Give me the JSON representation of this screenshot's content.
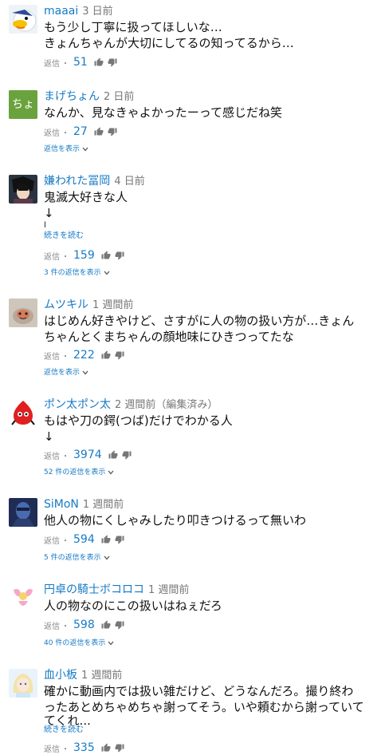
{
  "ui": {
    "reply_label": "返信",
    "dot": "・",
    "read_more": "続きを読む",
    "show_replies": "返信を表示"
  },
  "comments": [
    {
      "author": "maaai",
      "time": "3 日前",
      "lines": [
        "もう少し丁寧に扱ってほしいな…",
        "きょんちゃんが大切にしてるの知ってるから…"
      ],
      "likes": "51",
      "avatar": {
        "type": "duck-icon",
        "colors": [
          "#f3c200",
          "#ffffff",
          "#f26a1b"
        ]
      }
    },
    {
      "author": "まげちょん",
      "time": "2 日前",
      "lines": [
        "なんか、見なきゃよかったーって感じだね笑"
      ],
      "likes": "27",
      "show_replies": "返信を表示",
      "avatar": {
        "type": "initials",
        "text": "ちょ",
        "bg": "#6aa33d"
      }
    },
    {
      "author": "嫌われた冨岡",
      "time": "4 日前",
      "lines": [
        "鬼滅大好きな人",
        "↓",
        "l"
      ],
      "read_more": "続きを読む",
      "likes": "159",
      "show_replies": "3 件の返信を表示",
      "avatar": {
        "type": "anime-portrait-icon",
        "colors": [
          "#1f2530",
          "#f0d6c0"
        ]
      }
    },
    {
      "author": "ムツキル",
      "time": "1 週間前",
      "lines": [
        "はじめん好きやけど、さすがに人の物の扱い方が…きょん",
        "ちゃんとくまちゃんの顔地味にひきつってたな"
      ],
      "likes": "222",
      "show_replies": "返信を表示",
      "avatar": {
        "type": "animal-photo-icon",
        "colors": [
          "#b8a898",
          "#d87a5a"
        ]
      }
    },
    {
      "author": "ポン太ポン太",
      "time": "2 週間前（編集済み）",
      "lines": [
        "もはや刀の鍔(つば)だけでわかる人",
        "↓"
      ],
      "likes": "3974",
      "show_replies": "52 件の返信を表示",
      "avatar": {
        "type": "red-character-icon",
        "colors": [
          "#e02020",
          "#111111"
        ]
      }
    },
    {
      "author": "SiMoN",
      "time": "1 週間前",
      "lines": [
        "他人の物にくしゃみしたり叩きつけるって無いわ"
      ],
      "likes": "594",
      "show_replies": "5 件の返信を表示",
      "avatar": {
        "type": "superhero-icon",
        "colors": [
          "#2c3e70",
          "#4a6ab0"
        ]
      }
    },
    {
      "author": "円卓の騎士ボコロコ",
      "time": "1 週間前",
      "lines": [
        "人の物なのにこの扱いはねぇだろ"
      ],
      "likes": "598",
      "show_replies": "40 件の返信を表示",
      "avatar": {
        "type": "fairy-icon",
        "colors": [
          "#f6a7c8",
          "#f6d36b"
        ]
      }
    },
    {
      "author": "血小板",
      "time": "1 週間前",
      "lines": [
        "確かに動画内では扱い雑だけど、どうなんだろ。撮り終わ",
        "ったあとめちゃめちゃ謝ってそう。いや頼むから謝っていて",
        "てくれ..."
      ],
      "read_more": "続きを読む",
      "likes": "335",
      "avatar": {
        "type": "anime-girl-icon",
        "colors": [
          "#f2e3a8",
          "#cfe6f5"
        ]
      }
    }
  ]
}
